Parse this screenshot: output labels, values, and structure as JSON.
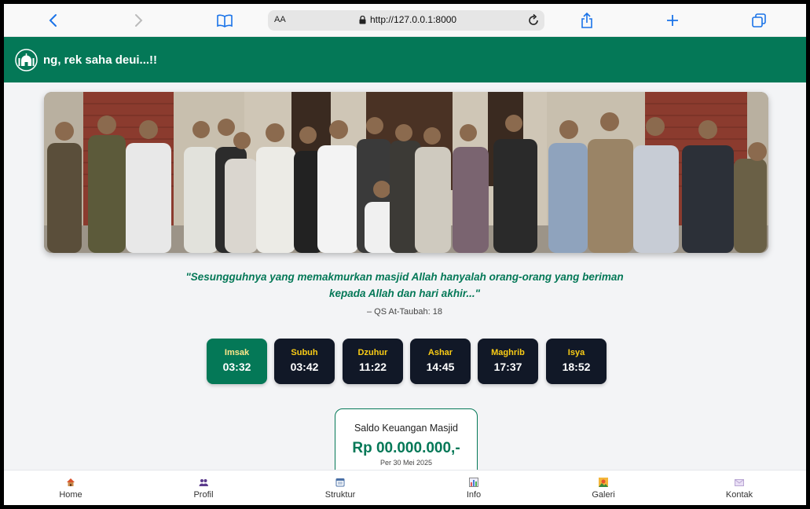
{
  "browser": {
    "text_size_label": "AA",
    "url": "http://127.0.0.1:8000"
  },
  "header": {
    "title": "ng, rek saha deui...!!"
  },
  "quote": {
    "text": "\"Sesungguhnya yang memakmurkan masjid Allah hanyalah orang-orang yang beriman kepada Allah dan hari akhir...\"",
    "source": "– QS At-Taubah: 18"
  },
  "prayer_times": [
    {
      "name": "Imsak",
      "time": "03:32",
      "active": true
    },
    {
      "name": "Subuh",
      "time": "03:42",
      "active": false
    },
    {
      "name": "Dzuhur",
      "time": "11:22",
      "active": false
    },
    {
      "name": "Ashar",
      "time": "14:45",
      "active": false
    },
    {
      "name": "Maghrib",
      "time": "17:37",
      "active": false
    },
    {
      "name": "Isya",
      "time": "18:52",
      "active": false
    }
  ],
  "finance": {
    "title": "Saldo Keuangan Masjid",
    "amount": "Rp 00.000.000,-",
    "date": "Per 30 Mei 2025"
  },
  "nav": [
    {
      "label": "Home",
      "icon": "house-icon"
    },
    {
      "label": "Profil",
      "icon": "people-icon"
    },
    {
      "label": "Struktur",
      "icon": "calendar-icon"
    },
    {
      "label": "Info",
      "icon": "bar-chart-icon"
    },
    {
      "label": "Galeri",
      "icon": "landscape-icon"
    },
    {
      "label": "Kontak",
      "icon": "envelope-icon"
    }
  ],
  "colors": {
    "brand_green": "#047857",
    "tile_dark": "#111827",
    "prayer_name": "#facc15",
    "browser_accent": "#1a73e8"
  }
}
